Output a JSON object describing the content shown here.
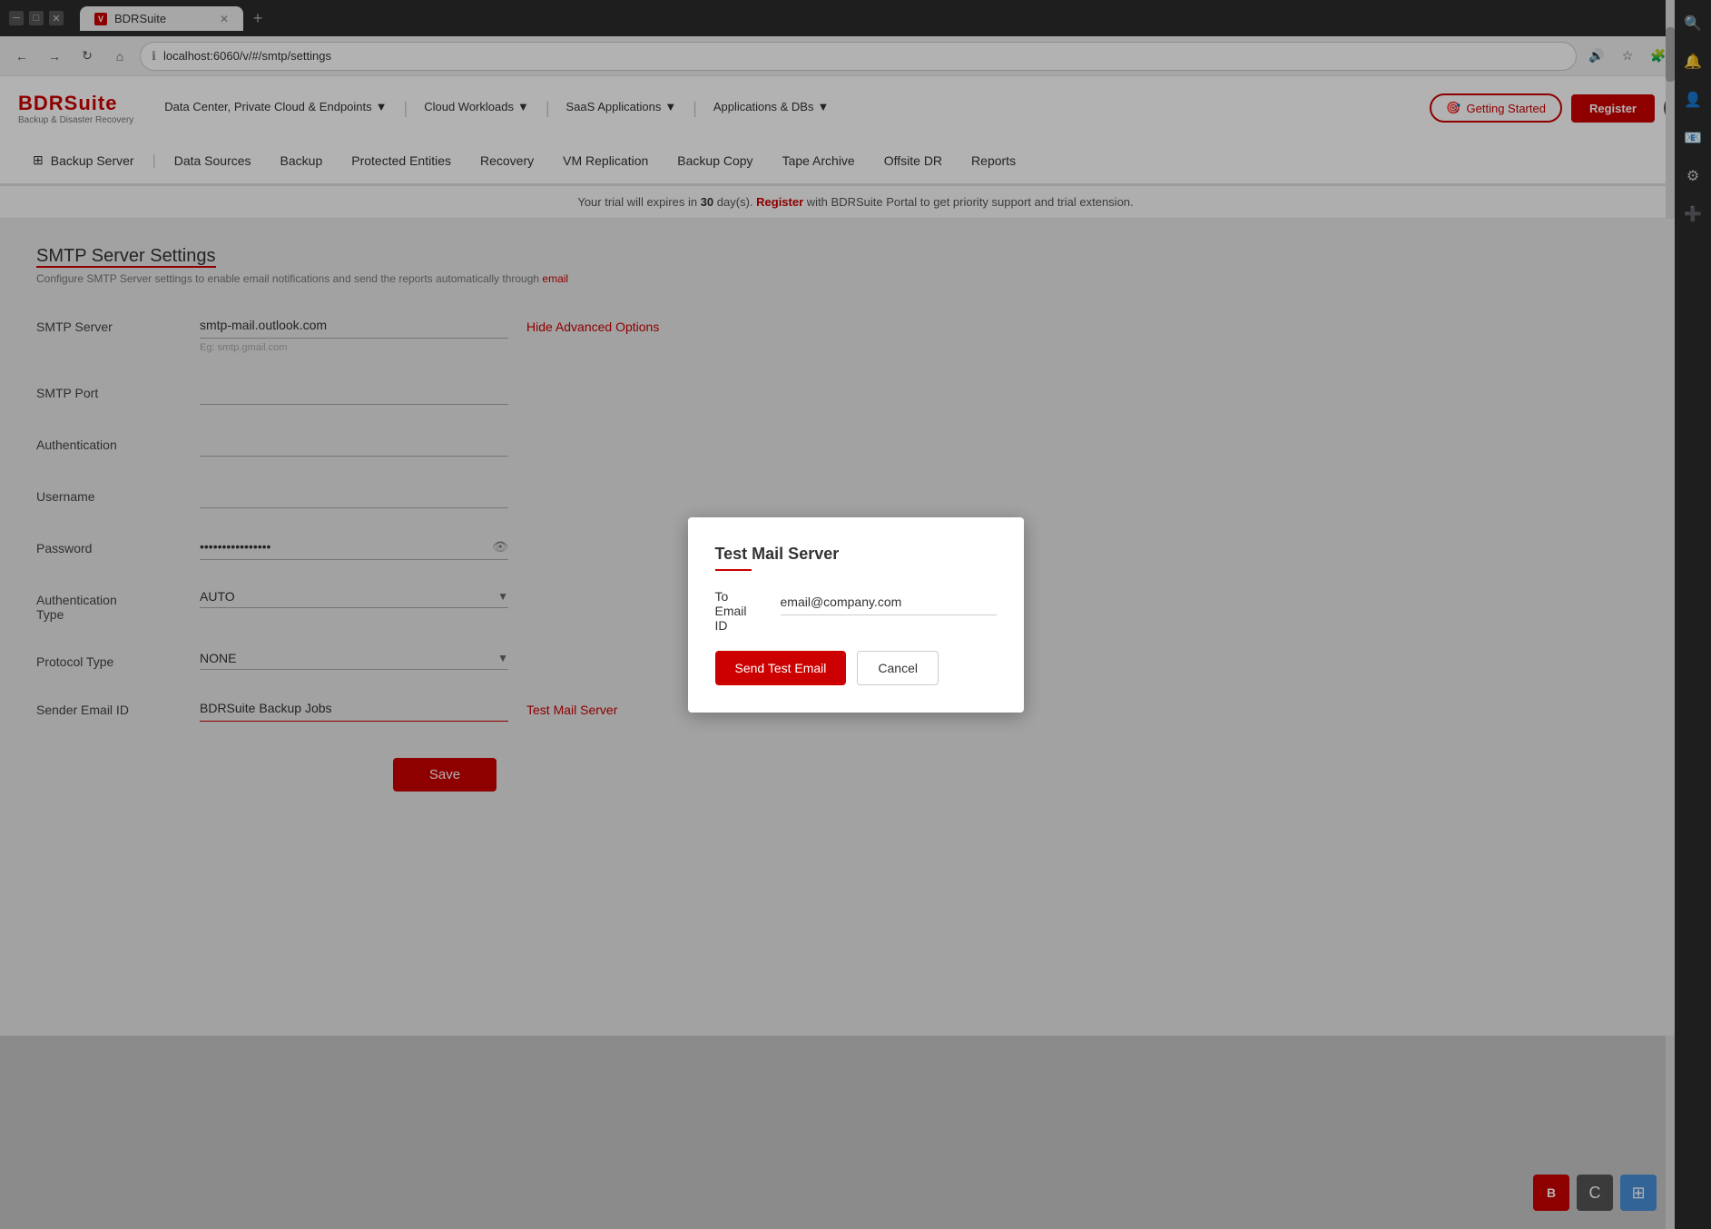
{
  "browser": {
    "tab_title": "BDRSuite",
    "url": "localhost:6060/v/#/smtp/settings",
    "favicon": "V",
    "new_tab_label": "+"
  },
  "app": {
    "logo_name": "BDRSuite",
    "logo_sub": "Backup & Disaster Recovery",
    "top_menus": [
      {
        "label": "Data Center, Private Cloud & Endpoints",
        "has_arrow": true
      },
      {
        "label": "Cloud Workloads",
        "has_arrow": true
      },
      {
        "label": "SaaS Applications",
        "has_arrow": true
      },
      {
        "label": "Applications & DBs",
        "has_arrow": true
      }
    ],
    "btn_getting_started": "Getting Started",
    "btn_register": "Register"
  },
  "secondary_nav": {
    "items": [
      {
        "id": "backup-server",
        "label": "Backup Server",
        "icon": "⊞"
      },
      {
        "id": "data-sources",
        "label": "Data Sources"
      },
      {
        "id": "backup",
        "label": "Backup"
      },
      {
        "id": "protected-entities",
        "label": "Protected Entities"
      },
      {
        "id": "recovery",
        "label": "Recovery"
      },
      {
        "id": "vm-replication",
        "label": "VM Replication"
      },
      {
        "id": "backup-copy",
        "label": "Backup Copy"
      },
      {
        "id": "tape-archive",
        "label": "Tape Archive"
      },
      {
        "id": "offsite-dr",
        "label": "Offsite DR"
      },
      {
        "id": "reports",
        "label": "Reports"
      }
    ]
  },
  "trial_banner": {
    "text_before": "Your trial will expires in ",
    "days": "30",
    "text_middle": " day(s). ",
    "link_text": "Register",
    "text_after": " with BDRSuite Portal to get priority support and trial extension."
  },
  "page": {
    "title_part1": "SMTP",
    "title_part2": " Server Settings",
    "subtitle": "Configure SMTP Server settings to enable email notifications and send the reports automatically through ",
    "subtitle_link": "email"
  },
  "form": {
    "smtp_server_label": "SMTP Server",
    "smtp_server_value": "smtp-mail.outlook.com",
    "smtp_server_hint": "Eg: smtp.gmail.com",
    "hide_advanced_label": "Hide Advanced Options",
    "smtp_port_label": "SMTP Port",
    "smtp_port_value": "",
    "authentication_label": "Authentication",
    "authentication_value": "",
    "username_label": "Username",
    "username_value": "",
    "password_label": "Password",
    "password_value": "••••••••••••••••",
    "auth_type_label": "Authentication Type",
    "auth_type_value": "AUTO",
    "protocol_type_label": "Protocol Type",
    "protocol_type_value": "NONE",
    "sender_email_label": "Sender Email ID",
    "sender_email_value": "BDRSuite Backup Jobs",
    "test_mail_link": "Test Mail Server",
    "save_label": "Save"
  },
  "dialog": {
    "title": "Test Mail Server",
    "to_label": "To",
    "email_label": "Email",
    "id_label": "ID",
    "email_value": "email@company.com",
    "send_test_label": "Send Test Email",
    "cancel_label": "Cancel"
  },
  "right_sidebar": {
    "icons": [
      "🔍",
      "🔔",
      "👤",
      "📧",
      "⚙",
      "➕"
    ]
  }
}
